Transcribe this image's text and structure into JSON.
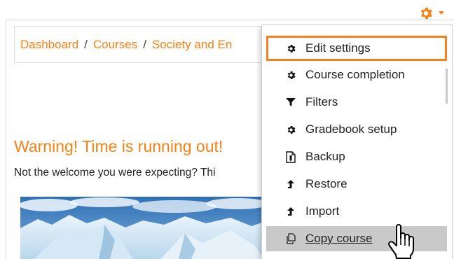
{
  "breadcrumb": {
    "items": [
      "Dashboard",
      "Courses",
      "Society and En"
    ],
    "separator": "/"
  },
  "content": {
    "warning_heading": "Warning! Time is running out!",
    "welcome_text": "Not the welcome you were expecting? Thi"
  },
  "header": {
    "gear_icon": "gear-icon",
    "caret_icon": "caret-down-icon"
  },
  "menu": {
    "items": [
      {
        "label": "Edit settings",
        "icon": "gear-icon",
        "state": "highlighted"
      },
      {
        "label": "Course completion",
        "icon": "gear-icon",
        "state": "normal"
      },
      {
        "label": "Filters",
        "icon": "filter-icon",
        "state": "normal"
      },
      {
        "label": "Gradebook setup",
        "icon": "gear-icon",
        "state": "normal"
      },
      {
        "label": "Backup",
        "icon": "file-icon",
        "state": "normal"
      },
      {
        "label": "Restore",
        "icon": "upload-icon",
        "state": "normal"
      },
      {
        "label": "Import",
        "icon": "upload-icon",
        "state": "normal"
      },
      {
        "label": "Copy course",
        "icon": "copy-icon",
        "state": "hover"
      }
    ]
  },
  "colors": {
    "accent": "#f98012",
    "highlight_border": "#f58220",
    "hover_bg": "#c9c9c9",
    "text": "#222222"
  }
}
